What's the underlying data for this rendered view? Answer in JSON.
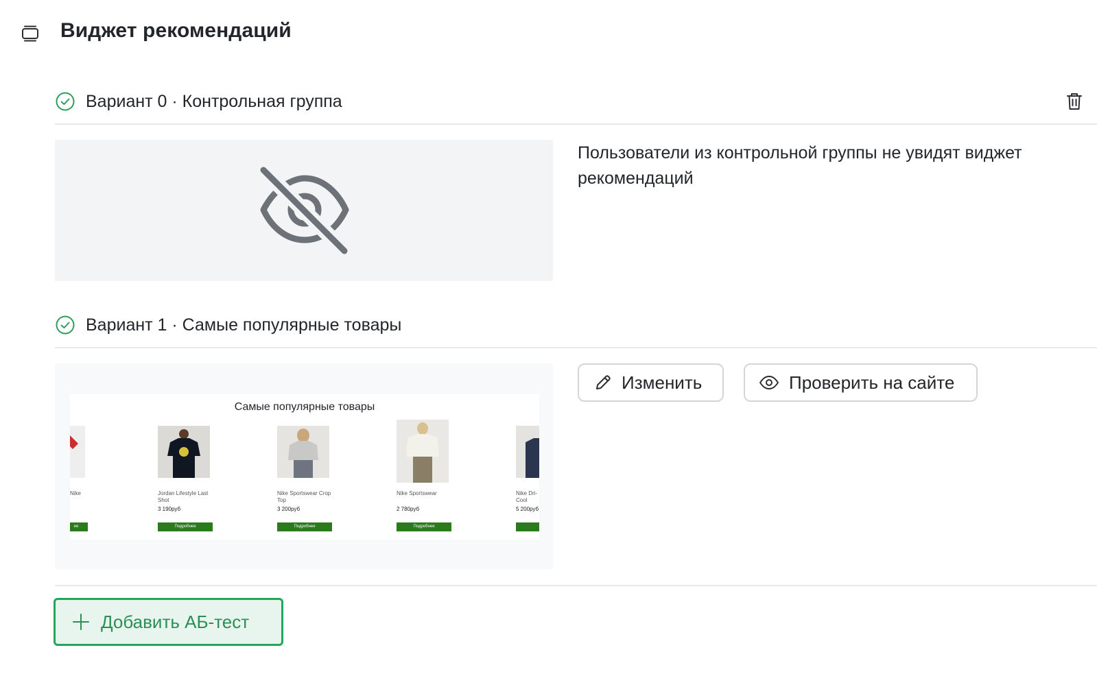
{
  "page": {
    "title": "Виджет рекомендаций"
  },
  "variants": [
    {
      "title": "Вариант 0 · Контрольная группа",
      "description": "Пользователи из контрольной группы не увидят виджет рекомендаций"
    },
    {
      "title": "Вариант 1 · Самые популярные товары",
      "actions": {
        "edit_label": "Изменить",
        "check_label": "Проверить на сайте"
      },
      "preview": {
        "widget_title": "Самые популярные товары",
        "products": [
          {
            "name": "Nike",
            "price": "",
            "button": "ее"
          },
          {
            "name": "Jordan Lifestyle Last Shot",
            "price": "3 190руб",
            "button": "Подробнее"
          },
          {
            "name": "Nike Sportswear Crop Top",
            "price": "3 200руб",
            "button": "Подробнее"
          },
          {
            "name": "Nike Sportswear",
            "price": "2 780руб",
            "button": "Подробнее"
          },
          {
            "name": "Nike Dri-Cool",
            "price": "5 200руб",
            "button": "По"
          }
        ]
      }
    }
  ],
  "add_test": {
    "label": "Добавить АБ-тест"
  },
  "colors": {
    "accent_green": "#25a55a",
    "product_button": "#2b7a1e",
    "text": "#22262a"
  },
  "icons": {
    "page": "layers-icon",
    "variant_status": "check-circle-icon",
    "delete": "trash-icon",
    "hidden": "eye-off-icon",
    "edit": "pencil-icon",
    "preview": "eye-icon",
    "add": "plus-icon"
  }
}
